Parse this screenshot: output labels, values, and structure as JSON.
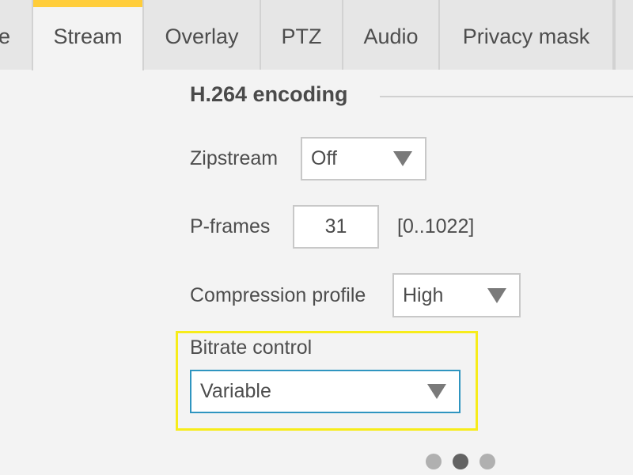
{
  "tabs": [
    {
      "label": "e",
      "active": false
    },
    {
      "label": "Stream",
      "active": true
    },
    {
      "label": "Overlay",
      "active": false
    },
    {
      "label": "PTZ",
      "active": false
    },
    {
      "label": "Audio",
      "active": false
    },
    {
      "label": "Privacy mask",
      "active": false
    },
    {
      "label": "",
      "active": false
    }
  ],
  "section": {
    "title": "H.264 encoding"
  },
  "fields": {
    "zipstream": {
      "label": "Zipstream",
      "value": "Off",
      "icon": "triangle-down-icon"
    },
    "p_frames": {
      "label": "P-frames",
      "value": "31",
      "range": "[0..1022]"
    },
    "compression_profile": {
      "label": "Compression profile",
      "value": "High",
      "icon": "triangle-down-icon"
    },
    "bitrate_control": {
      "label": "Bitrate control",
      "value": "Variable",
      "icon": "triangle-down-icon"
    }
  },
  "colors": {
    "accent_tab": "#ffcd3a",
    "highlight": "#f7ec1a",
    "focus_border": "#2f95c0"
  },
  "pagination": {
    "total": 3,
    "current": 2
  }
}
